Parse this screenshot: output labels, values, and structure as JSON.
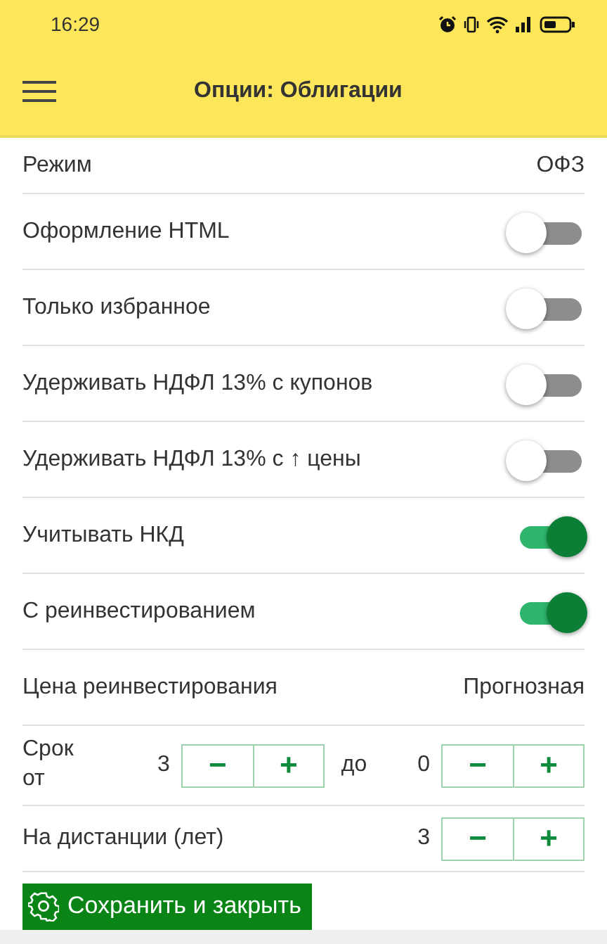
{
  "status_bar": {
    "time": "16:29"
  },
  "header": {
    "title": "Опции: Облигации"
  },
  "rows": [
    {
      "kind": "value",
      "label": "Режим",
      "value": "ОФЗ"
    },
    {
      "kind": "toggle",
      "label": "Оформление HTML",
      "on": false
    },
    {
      "kind": "toggle",
      "label": "Только избранное",
      "on": false
    },
    {
      "kind": "toggle",
      "label": "Удерживать НДФЛ 13% с купонов",
      "on": false
    },
    {
      "kind": "toggle",
      "label": "Удерживать НДФЛ 13% с ↑ цены",
      "on": false
    },
    {
      "kind": "toggle",
      "label": "Учитывать НКД",
      "on": true
    },
    {
      "kind": "toggle",
      "label": "С реинвестированием",
      "on": true
    },
    {
      "kind": "value",
      "label": "Цена реинвестирования",
      "value": "Прогнозная"
    },
    {
      "kind": "range",
      "label": "Срок от",
      "from": {
        "value": "3",
        "minus": "−",
        "plus": "+"
      },
      "separator": "до",
      "to": {
        "value": "0",
        "minus": "−",
        "plus": "+"
      }
    },
    {
      "kind": "stepper",
      "label": "На дистанции (лет)",
      "stepper": {
        "value": "3",
        "minus": "−",
        "plus": "+"
      }
    }
  ],
  "save_button": {
    "label": "Сохранить и закрыть"
  }
}
